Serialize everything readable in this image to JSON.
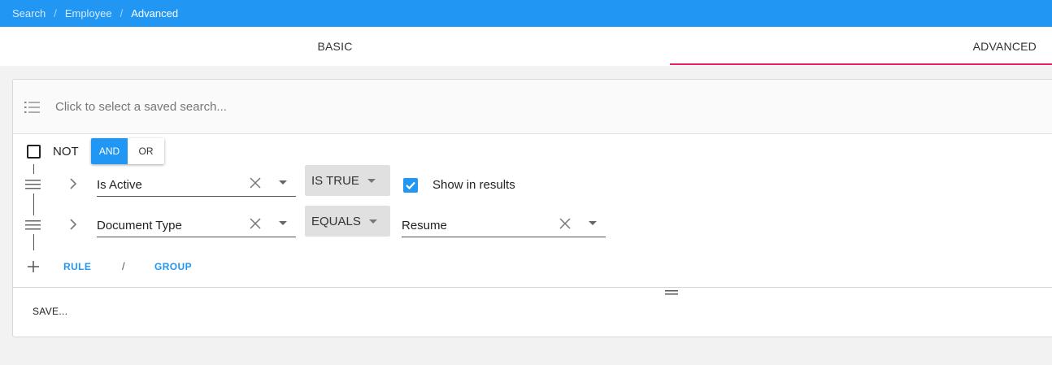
{
  "breadcrumb": {
    "items": [
      "Search",
      "Employee",
      "Advanced"
    ],
    "separator": "/"
  },
  "tabs": {
    "basic": "BASIC",
    "advanced": "ADVANCED",
    "active": "ADVANCED"
  },
  "saved_search": {
    "placeholder": "Click to select a saved search..."
  },
  "group": {
    "not_label": "NOT",
    "not_checked": false,
    "and_label": "AND",
    "or_label": "OR",
    "combinator": "AND"
  },
  "rules": [
    {
      "field": "Is Active",
      "operator": "IS TRUE",
      "show_in_results_label": "Show in results",
      "show_in_results": true
    },
    {
      "field": "Document Type",
      "operator": "EQUALS",
      "value": "Resume"
    }
  ],
  "actions": {
    "rule_label": "RULE",
    "separator": "/",
    "group_label": "GROUP",
    "save_label": "SAVE..."
  },
  "colors": {
    "primary": "#2196f3",
    "tab_indicator": "#e91e63",
    "operator_bg": "#e0e0e0"
  }
}
